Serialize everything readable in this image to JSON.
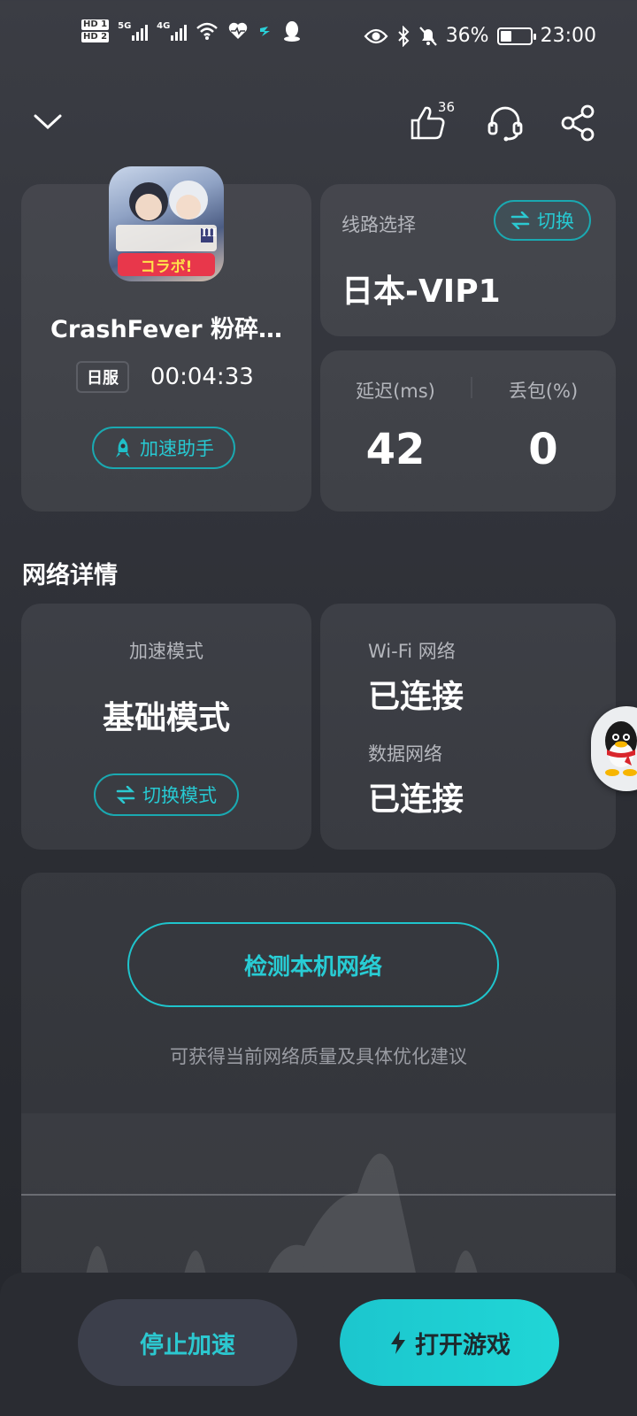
{
  "status_bar": {
    "hd1": "HD 1",
    "hd2": "HD 2",
    "sig1_label": "5G",
    "sig2_label": "4G",
    "battery_percent": "36%",
    "battery_level": 0.36,
    "time": "23:00"
  },
  "top_bar": {
    "like_count": "36"
  },
  "game": {
    "title": "CrashFever 粉碎…",
    "region": "日服",
    "elapsed": "00:04:33",
    "assistant_label": "加速助手",
    "icon_caption": "コラボ!",
    "icon_badge": "III"
  },
  "route": {
    "label": "线路选择",
    "switch_label": "切换",
    "value": "日本-VIP1"
  },
  "latency": {
    "latency_label": "延迟(ms)",
    "latency_value": "42",
    "loss_label": "丢包(%)",
    "loss_value": "0"
  },
  "network": {
    "section_title": "网络详情",
    "mode_label": "加速模式",
    "mode_value": "基础模式",
    "switch_mode_label": "切换模式",
    "wifi_label": "Wi-Fi 网络",
    "wifi_value": "已连接",
    "data_label": "数据网络",
    "data_value": "已连接"
  },
  "detect": {
    "button_label": "检测本机网络",
    "hint": "可获得当前网络质量及具体优化建议"
  },
  "actions": {
    "stop_label": "停止加速",
    "open_label": "打开游戏"
  },
  "colors": {
    "accent": "#1cc6ce",
    "background": "#31333a"
  }
}
